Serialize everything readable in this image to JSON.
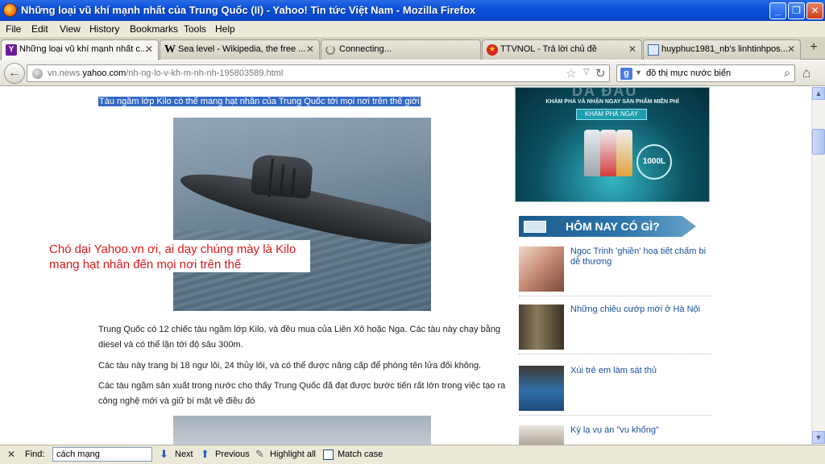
{
  "window": {
    "title": "Những loại vũ khí mạnh nhất của Trung Quốc (II) - Yahoo! Tin tức Việt Nam - Mozilla Firefox",
    "min_glyph": "_",
    "max_glyph": "❐",
    "close_glyph": "✕"
  },
  "menu": [
    "File",
    "Edit",
    "View",
    "History",
    "Bookmarks",
    "Tools",
    "Help"
  ],
  "tabs": [
    {
      "label": "Những loại vũ khí mạnh nhất c...",
      "icon": "yahoo-icon",
      "active": true
    },
    {
      "label": "Sea level - Wikipedia, the free ...",
      "icon": "wikipedia-icon",
      "active": false
    },
    {
      "label": "Connecting...",
      "icon": "loading-icon",
      "active": false
    },
    {
      "label": "TTVNOL - Trả lời chủ đề",
      "icon": "ttvnol-icon",
      "active": false
    },
    {
      "label": "huyphuc1981_nb's linhtinhpos...",
      "icon": "page-icon",
      "active": false
    }
  ],
  "tab_close_glyph": "✕",
  "newtab_glyph": "+",
  "nav": {
    "back_glyph": "←",
    "url_prefix": "vn.news.",
    "url_domain": "yahoo.com",
    "url_path": "/nh-ng-lo-v-kh-m-nh-nh-195803589.html",
    "star_glyph": "☆",
    "dropdown_glyph": "▽",
    "reload_glyph": "↻",
    "search_engine_letter": "g",
    "search_value": "đồ thị mực nước biển",
    "search_glyph": "⌕",
    "home_glyph": "⌂"
  },
  "article": {
    "caption": "Tàu ngầm lớp Kilo có thể mang hạt nhân của Trung Quốc tới mọi nơi trên thế giới",
    "overlay_note": "Chó dại Yahoo.vn ơi, ai dạy chúng mày là Kilo mang hạt nhân đến mọi nơi trên thế",
    "paragraphs": [
      "Trung Quốc có 12 chiếc tàu ngầm lớp Kilo, và đều mua của Liên Xô hoặc Nga. Các tàu này chạy bằng diesel và có thể lặn tới độ sâu 300m.",
      "Các tàu này trang bị 18 ngư lôi, 24 thủy lôi, và có thể được nâng cấp để phóng tên lửa đối không.",
      "Các tàu ngầm sản xuất trong nước cho thấy Trung Quốc đã đạt được bước tiến rất lớn trong việc tạo ra công nghệ mới và giữ bí mật về điều đó"
    ]
  },
  "sidebar": {
    "ad": {
      "top_text": "KHÁM PHÁ VÀ NHẬN NGAY SẢN PHẨM MIỄN PHÍ",
      "button": "KHÁM PHÁ NGAY",
      "volume": "1000L",
      "big_text": "DA ĐẦU"
    },
    "section_title": "HÔM NAY CÓ GÌ?",
    "news": [
      {
        "title": "Ngọc Trinh 'ghiền' hoạ tiết chấm bi dễ thương"
      },
      {
        "title": "Những chiêu cướp mới ở Hà Nội"
      },
      {
        "title": "Xúi trẻ em làm sát thủ"
      },
      {
        "title": "Kỳ lạ vụ án \"vu khống\""
      }
    ]
  },
  "scrollbar": {
    "up_glyph": "▲",
    "down_glyph": "▼"
  },
  "findbar": {
    "close_glyph": "✕",
    "label": "Find:",
    "value": "cách mạng",
    "next": "Next",
    "previous": "Previous",
    "highlight": "Highlight all",
    "match_case": "Match case"
  },
  "colors": {
    "titlebar": "#0a4fd6",
    "caption_highlight": "#3369c6",
    "overlay_text": "#e0161a",
    "link": "#1a4f9c"
  }
}
